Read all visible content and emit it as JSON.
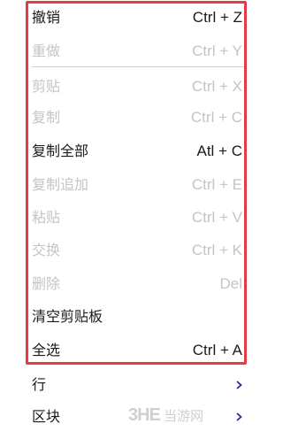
{
  "menu": {
    "items": [
      {
        "label": "撤销",
        "shortcut": "Ctrl + Z",
        "enabled": true
      },
      {
        "label": "重做",
        "shortcut": "Ctrl + Y",
        "enabled": false
      },
      {
        "label": "剪贴",
        "shortcut": "Ctrl + X",
        "enabled": false
      },
      {
        "label": "复制",
        "shortcut": "Ctrl + C",
        "enabled": false
      },
      {
        "label": "复制全部",
        "shortcut": "Atl + C",
        "enabled": true
      },
      {
        "label": "复制追加",
        "shortcut": "Ctrl + E",
        "enabled": false
      },
      {
        "label": "粘贴",
        "shortcut": "Ctrl + V",
        "enabled": false
      },
      {
        "label": "交换",
        "shortcut": "Ctrl + K",
        "enabled": false
      },
      {
        "label": "删除",
        "shortcut": "Del",
        "enabled": false
      },
      {
        "label": "清空剪贴板",
        "shortcut": "",
        "enabled": true
      },
      {
        "label": "全选",
        "shortcut": "Ctrl + A",
        "enabled": true
      }
    ],
    "submenus": [
      {
        "label": "行"
      },
      {
        "label": "区块"
      }
    ]
  },
  "watermark": {
    "logo": "3HE",
    "text": "当游网"
  },
  "colors": {
    "highlight_border": "#e53a45",
    "disabled_text": "#c4c4c4",
    "chevron": "#2a2f8f"
  }
}
